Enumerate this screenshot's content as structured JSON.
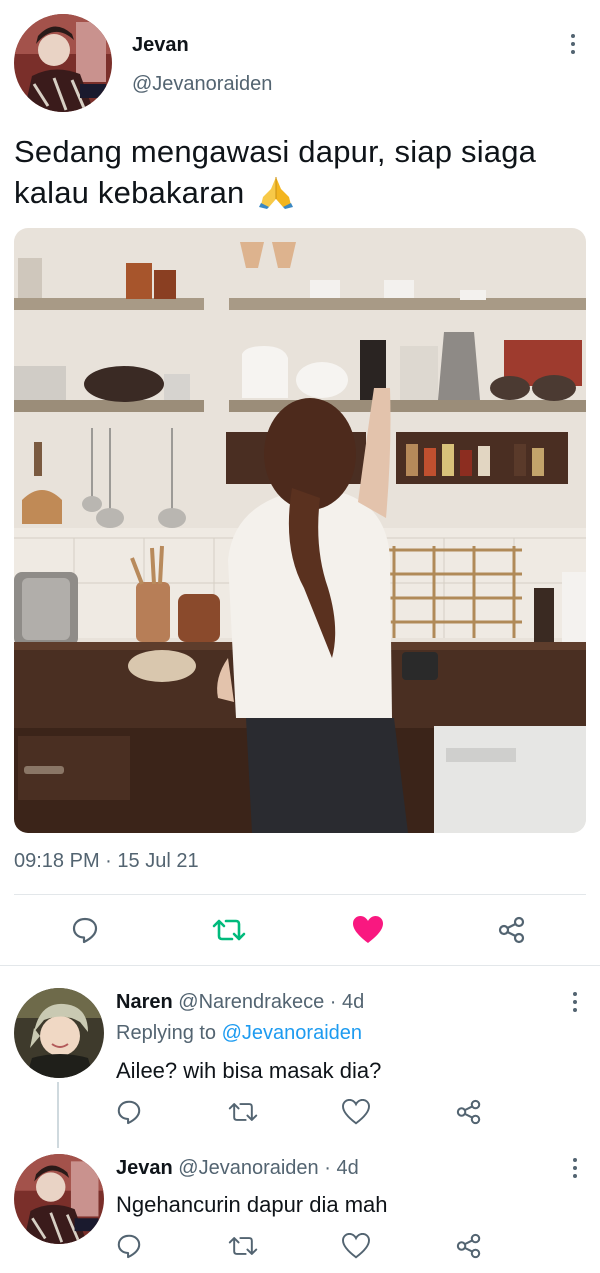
{
  "tweet": {
    "author_name": "Jevan",
    "author_handle": "@Jevanoraiden",
    "text": "Sedang mengawasi dapur, siap siaga kalau kebakaran",
    "emoji": "🙏",
    "time": "09:18 PM",
    "separator": "·",
    "date": "15 Jul 21",
    "liked": true,
    "accent_like": "#f91880",
    "accent_retweet": "#00ba7c"
  },
  "replies": [
    {
      "name": "Naren",
      "handle": "@Narendrakece",
      "age": "· 4d",
      "replying_prefix": "Replying to",
      "replying_to": "@Jevanoraiden",
      "text": "Ailee? wih bisa masak dia?"
    },
    {
      "name": "Jevan",
      "handle": "@Jevanoraiden",
      "age": "· 4d",
      "text": "Ngehancurin dapur dia mah"
    }
  ],
  "colors": {
    "text_primary": "#0f1419",
    "text_secondary": "#536471",
    "link": "#1d9bf0",
    "divider": "#e3e7ea"
  },
  "icons": {
    "reply": "speech-bubble-icon",
    "retweet": "retweet-icon",
    "like": "heart-icon",
    "share": "share-nodes-icon",
    "more": "vertical-dots-icon"
  }
}
